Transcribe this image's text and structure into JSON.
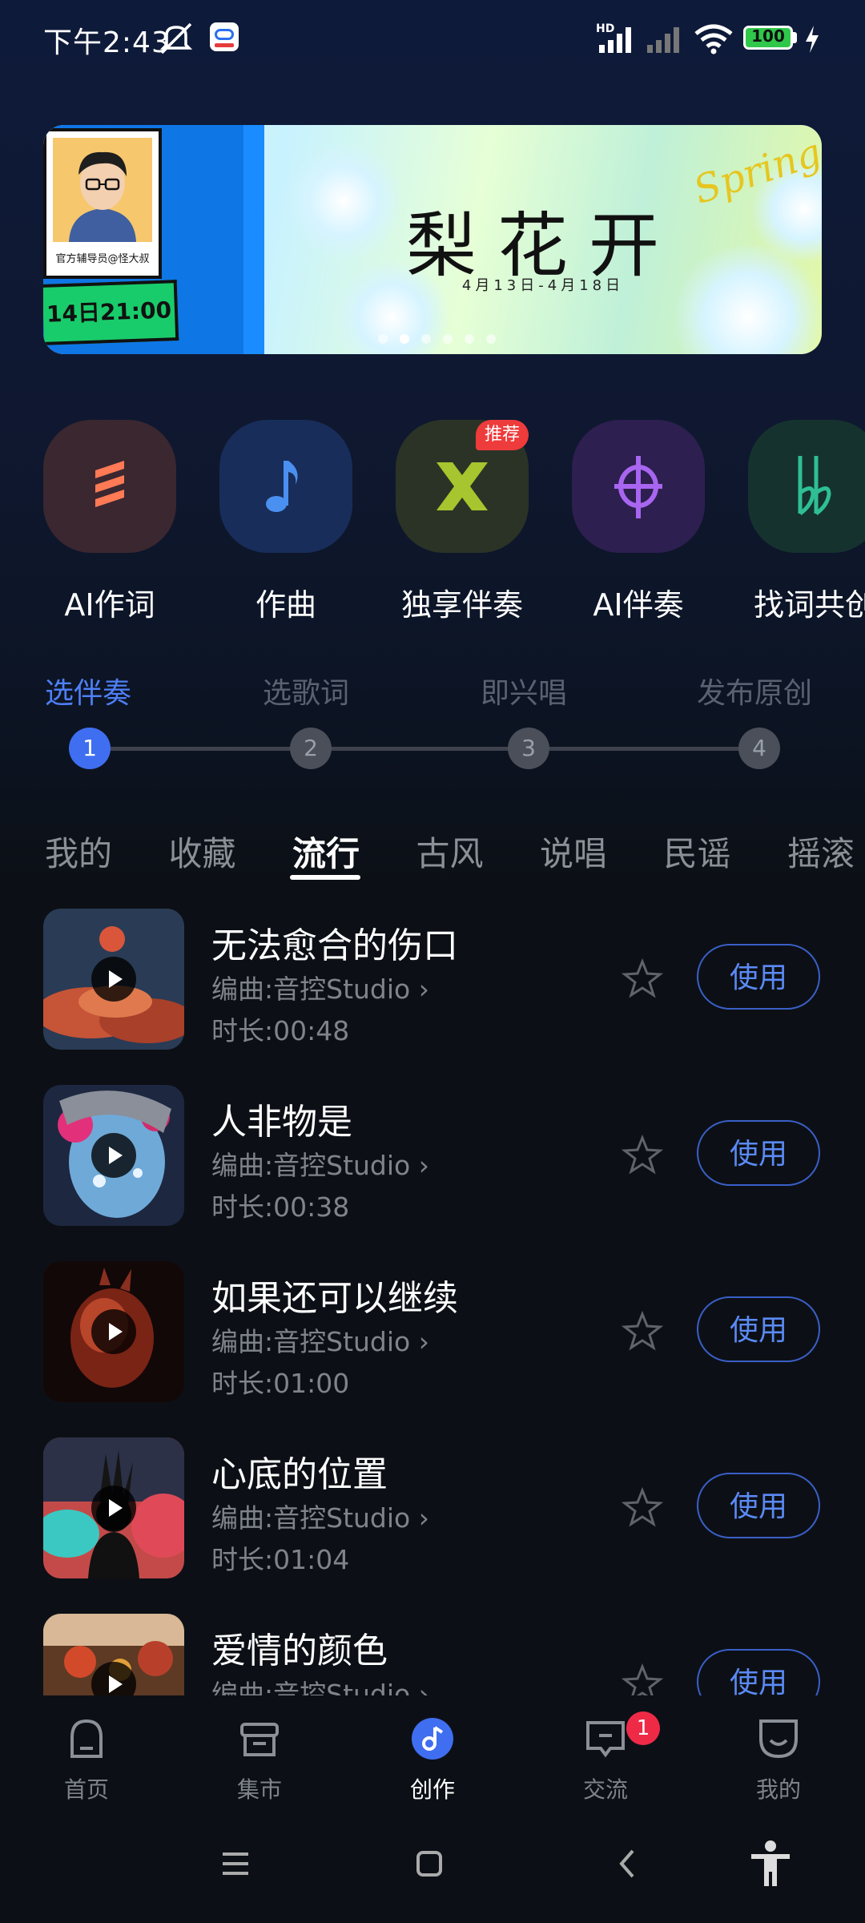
{
  "status_bar": {
    "time": "下午2:43",
    "network_label": "HD",
    "battery": "100",
    "icons": [
      "mute-icon",
      "app-notification-icon",
      "signal-icon",
      "signal-weak-icon",
      "wifi-icon",
      "battery-icon",
      "charging-icon"
    ]
  },
  "banner": {
    "poster_caption": "官方辅导员@怪大叔",
    "date_tag": "14日21:00",
    "title": "梨花开",
    "subtitle": "4月13日-4月18日",
    "script_text": "Spring",
    "page_count": 6,
    "active_page": 1
  },
  "tools": [
    {
      "label": "AI作词",
      "icon": "lyrics-stripes-icon",
      "color": "#ff7a55"
    },
    {
      "label": "作曲",
      "icon": "music-note-icon",
      "color": "#4a90f0"
    },
    {
      "label": "独享伴奏",
      "icon": "cross-arrows-icon",
      "color": "#a6c52e",
      "badge": "推荐"
    },
    {
      "label": "AI伴奏",
      "icon": "crosshair-icon",
      "color": "#a866f0"
    },
    {
      "label": "找词共创",
      "icon": "double-flat-icon",
      "color": "#2fbf95"
    }
  ],
  "steps": [
    {
      "label": "选伴奏",
      "number": "1",
      "active": true
    },
    {
      "label": "选歌词",
      "number": "2",
      "active": false
    },
    {
      "label": "即兴唱",
      "number": "3",
      "active": false
    },
    {
      "label": "发布原创",
      "number": "4",
      "active": false
    }
  ],
  "genres": [
    {
      "label": "我的",
      "active": false
    },
    {
      "label": "收藏",
      "active": false
    },
    {
      "label": "流行",
      "active": true
    },
    {
      "label": "古风",
      "active": false
    },
    {
      "label": "说唱",
      "active": false
    },
    {
      "label": "民谣",
      "active": false
    },
    {
      "label": "摇滚",
      "active": false
    }
  ],
  "songs": [
    {
      "title": "无法愈合的伤口",
      "composer": "编曲:音控Studio",
      "duration": "时长:00:48",
      "use_label": "使用",
      "cover": "cloud-moon"
    },
    {
      "title": "人非物是",
      "composer": "编曲:音控Studio",
      "duration": "时长:00:38",
      "use_label": "使用",
      "cover": "face-splash"
    },
    {
      "title": "如果还可以继续",
      "composer": "编曲:音控Studio",
      "duration": "时长:01:00",
      "use_label": "使用",
      "cover": "heart"
    },
    {
      "title": "心底的位置",
      "composer": "编曲:音控Studio",
      "duration": "时长:01:04",
      "use_label": "使用",
      "cover": "silhouette"
    },
    {
      "title": "爱情的颜色",
      "composer": "编曲:音控Studio",
      "duration": "",
      "use_label": "使用",
      "cover": "lanterns"
    }
  ],
  "bottom_nav": [
    {
      "label": "首页",
      "icon": "home-icon",
      "active": false
    },
    {
      "label": "集市",
      "icon": "market-icon",
      "active": false
    },
    {
      "label": "创作",
      "icon": "create-icon",
      "active": true
    },
    {
      "label": "交流",
      "icon": "chat-icon",
      "active": false,
      "badge": "1"
    },
    {
      "label": "我的",
      "icon": "profile-icon",
      "active": false
    }
  ],
  "system_nav": [
    "menu-icon",
    "home-square-icon",
    "back-icon",
    "accessibility-icon"
  ]
}
